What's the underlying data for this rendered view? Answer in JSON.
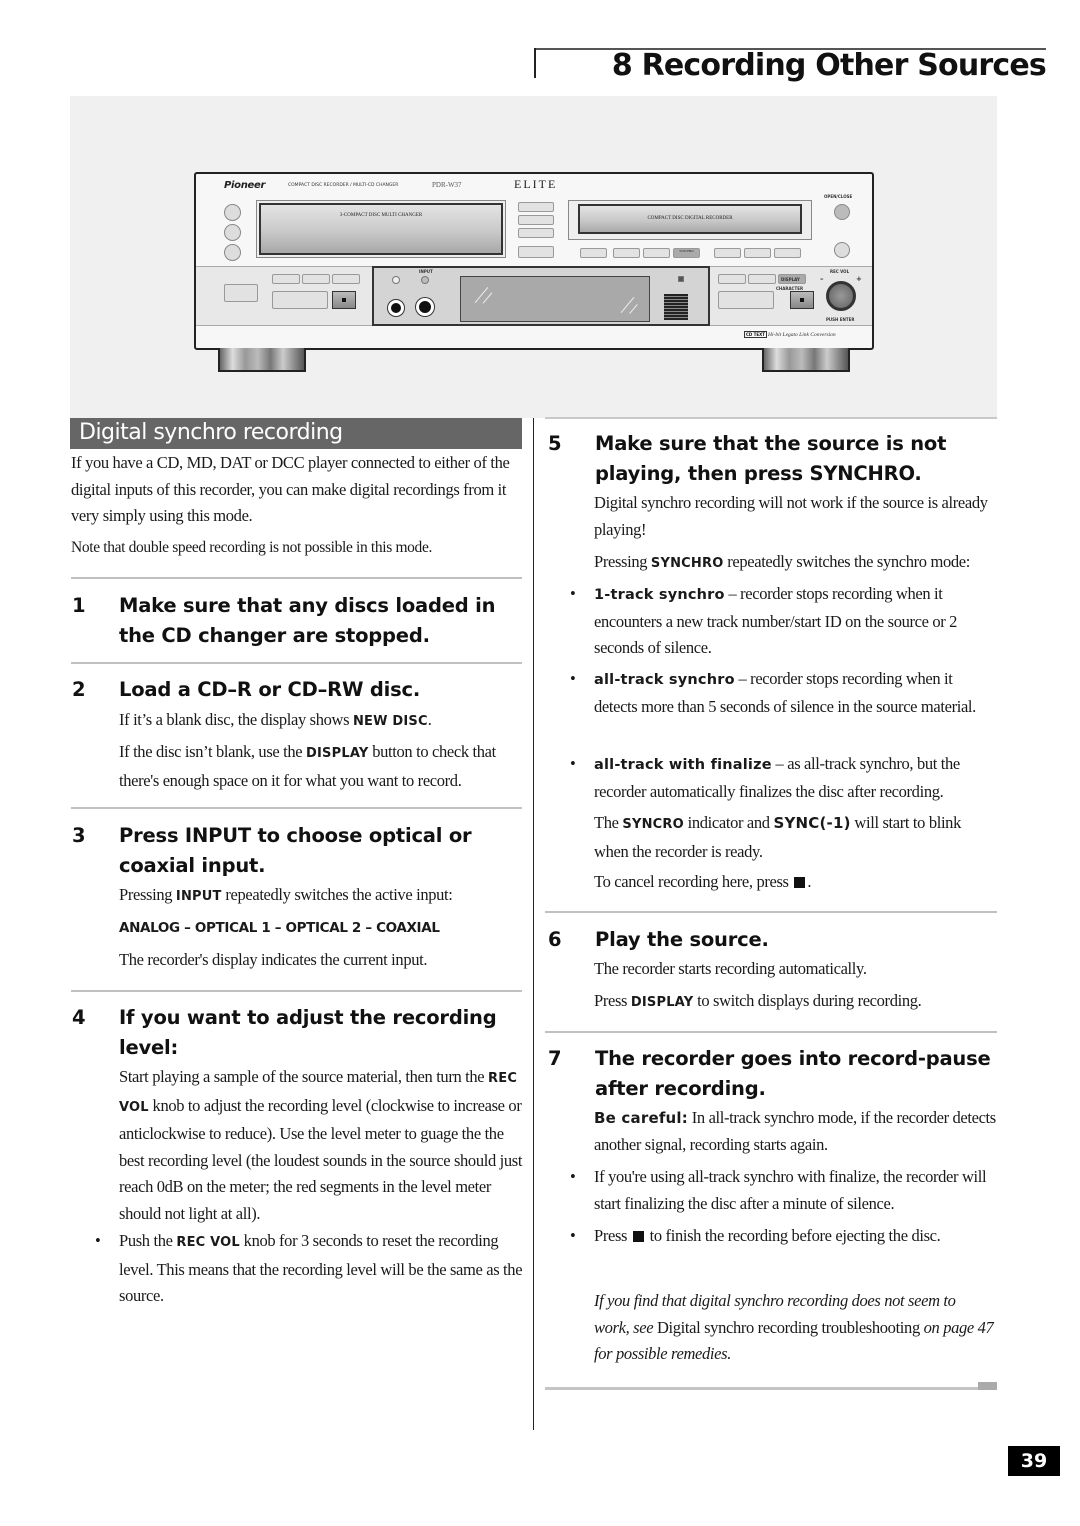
{
  "header": {
    "chapter_title": "8 Recording Other Sources"
  },
  "illustration": {
    "brand": "Pioneer",
    "brand_description": "COMPACT DISC RECORDER / MULTI-CD CHANGER",
    "model": "PDR-W37",
    "series": "ELITE",
    "changer_label": "3-COMPACT DISC MULTI CHANGER",
    "recorder_label": "COMPACT DISC DIGITAL RECORDER",
    "open_close_label": "OPEN/CLOSE",
    "synchro_label": "SYNCHRO",
    "input_label": "INPUT",
    "display_label": "DISPLAY",
    "character_label": "CHARACTER",
    "rec_vol_label": "REC VOL",
    "push_enter_label": "PUSH ENTER",
    "minus_label": "–",
    "plus_label": "+",
    "cd_text_label": "CD TEXT",
    "legato_label": "Hi-bit Legato Link Conversion"
  },
  "left": {
    "section_title": "Digital synchro recording",
    "intro": "If you have a CD, MD, DAT or DCC player connected to either of the digital inputs of this recorder, you can make digital recordings from it very simply using this mode.",
    "note": "Note that double speed recording is not possible in this mode.",
    "step1": {
      "num": "1",
      "title": "Make sure that any discs loaded in the CD changer are stopped."
    },
    "step2": {
      "num": "2",
      "title": "Load a CD–R or CD–RW disc.",
      "p1_a": "If it’s a blank disc, the display shows ",
      "p1_b": "NEW DISC",
      "p1_c": ".",
      "p2_a": "If the disc isn’t blank, use the ",
      "p2_b": "DISPLAY",
      "p2_c": " button to check that there's enough space on it for what you want to record."
    },
    "step3": {
      "num": "3",
      "title": "Press INPUT to choose optical or coaxial input.",
      "p1_a": "Pressing ",
      "p1_b": "INPUT",
      "p1_c": " repeatedly switches the active input:",
      "sequence": "ANALOG – OPTICAL 1 – OPTICAL 2 – COAXIAL",
      "p2": "The recorder's display indicates the current input."
    },
    "step4": {
      "num": "4",
      "title": "If you want to adjust the recording level:",
      "p1_a": "Start playing a sample of the source material, then turn the ",
      "p1_b": "REC VOL",
      "p1_c": " knob to adjust the recording level (clockwise to increase or anticlockwise to reduce). Use the level meter to guage the the best recording level (the loudest sounds in the source should just reach 0dB on the meter; the red segments in the level meter  should not light at all).",
      "bullet_a": "Push the ",
      "bullet_b": "REC VOL",
      "bullet_c": " knob for 3 seconds to reset the recording level. This means that the recording level will be the same as the source."
    }
  },
  "right": {
    "step5": {
      "num": "5",
      "title": "Make sure that the source is not playing, then press SYNCHRO.",
      "p1": "Digital synchro recording will not work if the source is already playing!",
      "p2_a": "Pressing ",
      "p2_b": "SYNCHRO",
      "p2_c": " repeatedly switches the synchro mode:",
      "modes": [
        {
          "name": "1-track synchro",
          "desc": " – recorder stops recording when it encounters a new track number/start ID on the source or 2 seconds of silence."
        },
        {
          "name": "all-track synchro",
          "desc": " – recorder stops recording when it detects more than 5 seconds of silence in the source material."
        },
        {
          "name": "all-track with finalize",
          "desc": " – as all-track synchro, but the recorder automatically finalizes the disc after recording."
        }
      ],
      "p3_a": "The ",
      "p3_b": "SYNCRO",
      "p3_c": " indicator and ",
      "p3_d": "SYNC(-1)",
      "p3_e": " will start to blink when the recorder is ready.",
      "p4_a": "To cancel recording here, press ",
      "p4_b": "."
    },
    "step6": {
      "num": "6",
      "title": "Play the source.",
      "p1": "The recorder starts recording automatically.",
      "p2_a": "Press ",
      "p2_b": "DISPLAY",
      "p2_c": " to switch displays during recording."
    },
    "step7": {
      "num": "7",
      "title": "The recorder goes into record-pause after recording.",
      "p1_a": "Be careful:",
      "p1_b": " In all-track synchro mode, if the recorder detects another signal, recording starts again.",
      "bullet1": "If you're using all-track synchro with finalize, the recorder will start finalizing the disc after a minute of silence.",
      "bullet2_a": "Press ",
      "bullet2_b": " to finish the recording before ejecting the disc."
    },
    "note_a": "If you find that digital synchro recording does not seem to work, see ",
    "note_b": "Digital synchro recording troubleshooting",
    "note_c": " on page 47 for possible remedies."
  },
  "footer": {
    "bullet_glyph": "•",
    "page_number": "39"
  }
}
